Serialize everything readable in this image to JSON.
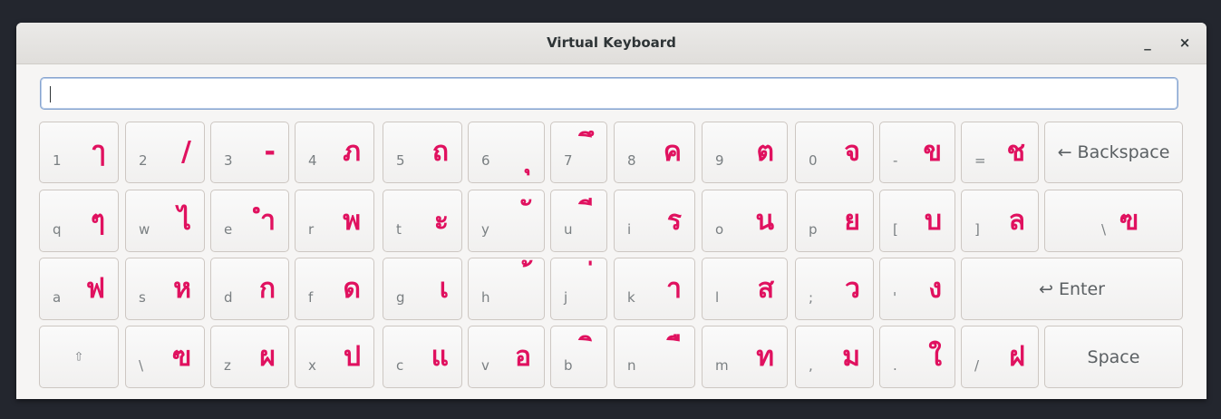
{
  "window": {
    "title": "Virtual Keyboard",
    "minimize_label": "_",
    "close_label": "×"
  },
  "text_entry": {
    "value": ""
  },
  "keyboard": {
    "rows": [
      {
        "name": "number-row",
        "keys": [
          {
            "latin": "1",
            "thai": "ๅ"
          },
          {
            "latin": "2",
            "thai": "/"
          },
          {
            "latin": "3",
            "thai": "-"
          },
          {
            "latin": "4",
            "thai": "ภ"
          },
          {
            "latin": "5",
            "thai": "ถ"
          },
          {
            "latin": "6",
            "thai": "ุ"
          },
          {
            "latin": "7",
            "thai": "ึ"
          },
          {
            "latin": "8",
            "thai": "ค"
          },
          {
            "latin": "9",
            "thai": "ต"
          },
          {
            "latin": "0",
            "thai": "จ"
          },
          {
            "latin": "-",
            "thai": "ข"
          },
          {
            "latin": "=",
            "thai": "ช"
          }
        ],
        "special": {
          "label": "← Backspace"
        }
      },
      {
        "name": "top-row",
        "keys": [
          {
            "latin": "q",
            "thai": "ๆ"
          },
          {
            "latin": "w",
            "thai": "ไ"
          },
          {
            "latin": "e",
            "thai": "ำ"
          },
          {
            "latin": "r",
            "thai": "พ"
          },
          {
            "latin": "t",
            "thai": "ะ"
          },
          {
            "latin": "y",
            "thai": "ั"
          },
          {
            "latin": "u",
            "thai": "ี"
          },
          {
            "latin": "i",
            "thai": "ร"
          },
          {
            "latin": "o",
            "thai": "น"
          },
          {
            "latin": "p",
            "thai": "ย"
          },
          {
            "latin": "[",
            "thai": "บ"
          },
          {
            "latin": "]",
            "thai": "ล"
          }
        ],
        "special": {
          "latin": "\\",
          "thai": "ฃ"
        }
      },
      {
        "name": "home-row",
        "keys": [
          {
            "latin": "a",
            "thai": "ฟ"
          },
          {
            "latin": "s",
            "thai": "ห"
          },
          {
            "latin": "d",
            "thai": "ก"
          },
          {
            "latin": "f",
            "thai": "ด"
          },
          {
            "latin": "g",
            "thai": "เ"
          },
          {
            "latin": "h",
            "thai": "้"
          },
          {
            "latin": "j",
            "thai": "่"
          },
          {
            "latin": "k",
            "thai": "า"
          },
          {
            "latin": "l",
            "thai": "ส"
          },
          {
            "latin": ";",
            "thai": "ว"
          },
          {
            "latin": "'",
            "thai": "ง"
          }
        ],
        "special": {
          "label": "↩ Enter"
        }
      },
      {
        "name": "bottom-row",
        "shift": {
          "label": "⇧"
        },
        "keys": [
          {
            "latin": "\\",
            "thai": "ฃ"
          },
          {
            "latin": "z",
            "thai": "ผ"
          },
          {
            "latin": "x",
            "thai": "ป"
          },
          {
            "latin": "c",
            "thai": "แ"
          },
          {
            "latin": "v",
            "thai": "อ"
          },
          {
            "latin": "b",
            "thai": "ิ"
          },
          {
            "latin": "n",
            "thai": "ื"
          },
          {
            "latin": "m",
            "thai": "ท"
          },
          {
            "latin": ",",
            "thai": "ม"
          },
          {
            "latin": ".",
            "thai": "ใ"
          },
          {
            "latin": "/",
            "thai": "ฝ"
          }
        ],
        "special": {
          "label": "Space"
        }
      }
    ]
  },
  "colors": {
    "thai_glyph": "#e0115f",
    "latin_glyph": "#7a7f82",
    "background": "#23262e"
  }
}
